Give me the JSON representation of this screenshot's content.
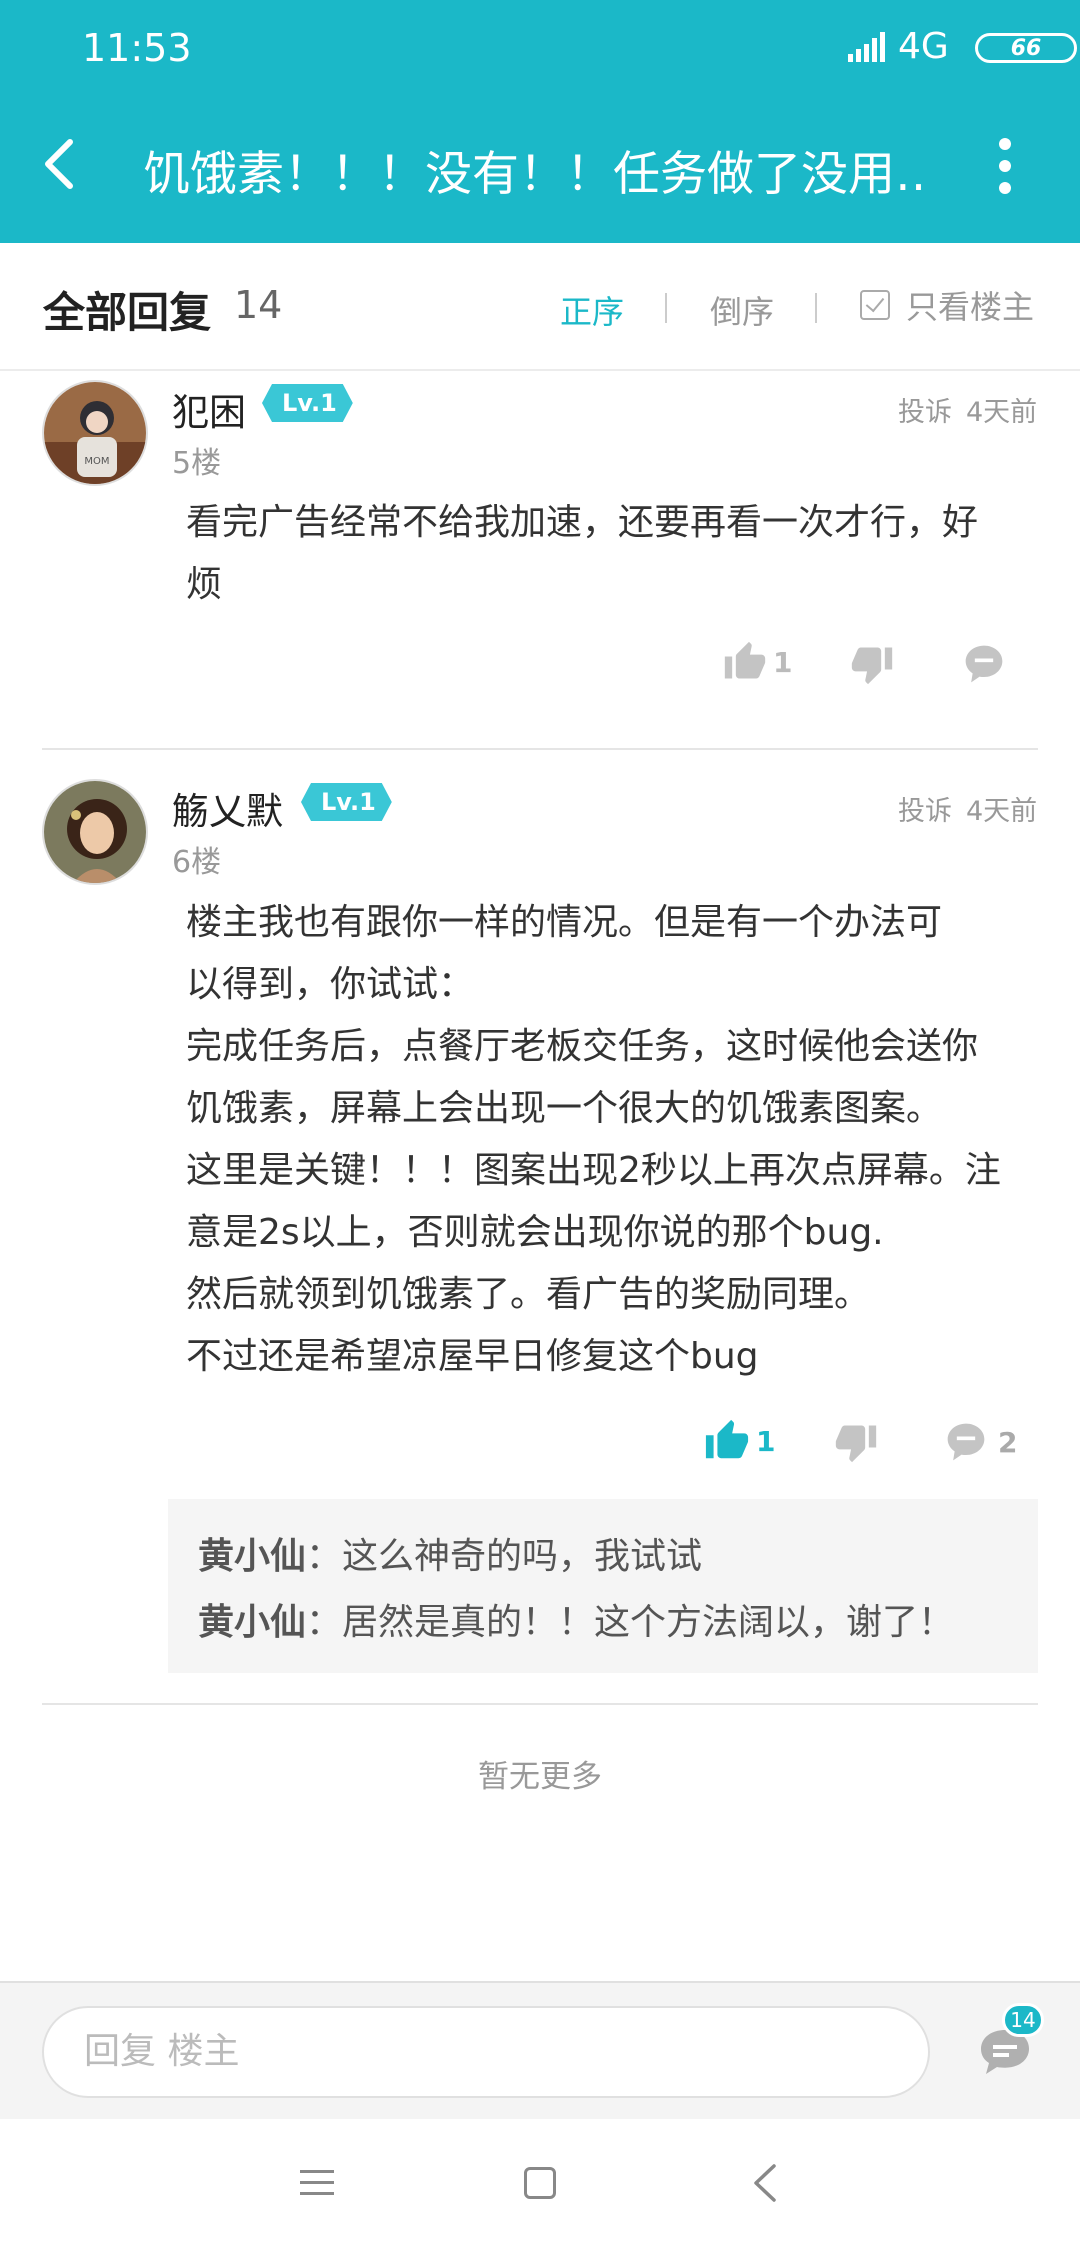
{
  "status_bar": {
    "time": "11:53",
    "network": "4G",
    "battery": "66"
  },
  "header": {
    "title": "饥饿素！！！没有！！任务做了没用…"
  },
  "sort_bar": {
    "all_replies_label": "全部回复",
    "count": "14",
    "ascending_label": "正序",
    "descending_label": "倒序",
    "op_only_label": "只看楼主"
  },
  "comments": [
    {
      "username": "犯困",
      "level": "Lv.1",
      "floor": "5楼",
      "report_label": "投诉",
      "time": "4天前",
      "lines": [
        "看完广告经常不给我加速，还要再看一次才行，好",
        "烦"
      ],
      "likes": "1",
      "liked": false
    },
    {
      "username": "觞乂默",
      "level": "Lv.1",
      "floor": "6楼",
      "report_label": "投诉",
      "time": "4天前",
      "lines": [
        "楼主我也有跟你一样的情况。但是有一个办法可",
        "以得到，你试试：",
        "完成任务后，点餐厅老板交任务，这时候他会送你",
        "饥饿素，屏幕上会出现一个很大的饥饿素图案。",
        "这里是关键！！！图案出现2秒以上再次点屏幕。注",
        "意是2s以上，否则就会出现你说的那个bug.",
        "然后就领到饥饿素了。看广告的奖励同理。",
        "不过还是希望凉屋早日修复这个bug"
      ],
      "likes": "1",
      "liked": true,
      "reply_count": "2",
      "replies": [
        {
          "user": "黄小仙",
          "text": "：这么神奇的吗，我试试"
        },
        {
          "user": "黄小仙",
          "text": "：居然是真的！！这个方法阔以，谢了！"
        }
      ]
    }
  ],
  "footer": {
    "no_more": "暂无更多"
  },
  "reply_bar": {
    "placeholder": "回复  楼主",
    "badge": "14"
  },
  "colors": {
    "accent": "#1bb8c8",
    "badge": "#3ac7d6",
    "muted": "#999999"
  },
  "icons": {
    "back": "chevron-left-icon",
    "more": "more-vertical-icon",
    "like": "thumbs-up-icon",
    "dislike": "thumbs-down-icon",
    "comment": "comment-bubble-icon",
    "checkbox": "checkbox-icon"
  }
}
